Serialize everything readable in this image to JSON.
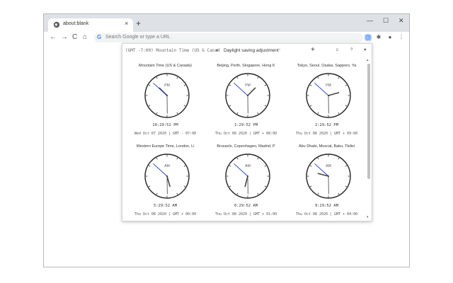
{
  "browser": {
    "tab_title": "about:blank",
    "tab_close": "×",
    "new_tab": "+",
    "minimize": "—",
    "maximize": "☐",
    "close": "✕",
    "back": "←",
    "forward": "→",
    "reload": "C",
    "home": "⌂",
    "omnibox_icon": "G",
    "omnibox_placeholder": "Search Google or type a URL"
  },
  "popup": {
    "timezone_select": "(GMT -7:00) Mountain Time (US & Canad",
    "timezone_arrow": "▾",
    "dst_label": "Daylight saving adjustment",
    "dst_toggle": "♀",
    "add_label": "+",
    "icon_settings": "c",
    "icon_help": "?",
    "icon_heart": "♥",
    "scroll_up": "▴",
    "scroll_down": "▾"
  },
  "clocks": [
    {
      "city": "Mountain Time (US & Canada)",
      "ampm": "PM",
      "time": "10:29:52 PM",
      "date": "Wed Oct 07 2020 | GMT - 07:00",
      "h": 22,
      "m": 29,
      "s": 52
    },
    {
      "city": "Beijing, Perth, Singapore, Hong K",
      "ampm": "PM",
      "time": "1:29:52 PM",
      "date": "Thu Oct 08 2020 | GMT + 08:00",
      "h": 13,
      "m": 29,
      "s": 52
    },
    {
      "city": "Tokyo, Seoul, Osaka, Sapporo, Ya",
      "ampm": "PM",
      "time": "2:29:52 PM",
      "date": "Thu Oct 08 2020 | GMT + 09:00",
      "h": 14,
      "m": 29,
      "s": 52
    },
    {
      "city": "Western Europe Time, London, Li",
      "ampm": "AM",
      "time": "5:29:52 AM",
      "date": "Thu Oct 08 2020 | GMT + 00:00",
      "h": 5,
      "m": 29,
      "s": 52
    },
    {
      "city": "Brussels, Copenhagen, Madrid, P",
      "ampm": "AM",
      "time": "6:29:52 AM",
      "date": "Thu Oct 08 2020 | GMT + 01:00",
      "h": 6,
      "m": 29,
      "s": 52
    },
    {
      "city": "Abu Dhabi, Muscat, Baku, Tbilisi",
      "ampm": "AM",
      "time": "9:29:52 AM",
      "date": "Thu Oct 08 2020 | GMT + 04:00",
      "h": 9,
      "m": 29,
      "s": 52
    }
  ]
}
